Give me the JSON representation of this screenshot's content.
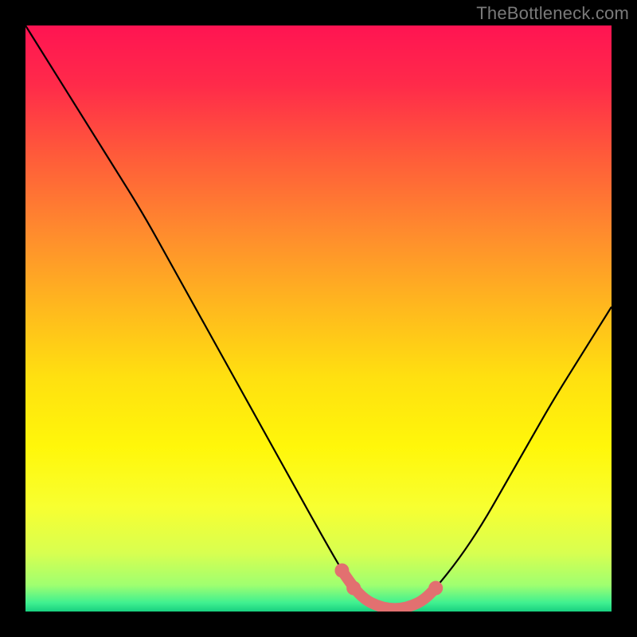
{
  "attribution": "TheBottleneck.com",
  "colors": {
    "frame": "#000000",
    "curve": "#000000",
    "marker": "#e27070",
    "gradient_stops": [
      {
        "offset": 0.0,
        "color": "#ff1452"
      },
      {
        "offset": 0.1,
        "color": "#ff2a4a"
      },
      {
        "offset": 0.22,
        "color": "#ff5a3a"
      },
      {
        "offset": 0.35,
        "color": "#ff8a2e"
      },
      {
        "offset": 0.48,
        "color": "#ffb81e"
      },
      {
        "offset": 0.6,
        "color": "#ffe010"
      },
      {
        "offset": 0.72,
        "color": "#fff70a"
      },
      {
        "offset": 0.82,
        "color": "#f8ff30"
      },
      {
        "offset": 0.9,
        "color": "#d8ff50"
      },
      {
        "offset": 0.955,
        "color": "#9fff70"
      },
      {
        "offset": 0.985,
        "color": "#40f090"
      },
      {
        "offset": 1.0,
        "color": "#18d080"
      }
    ]
  },
  "chart_data": {
    "type": "line",
    "title": "",
    "xlabel": "",
    "ylabel": "",
    "xlim": [
      0,
      100
    ],
    "ylim": [
      0,
      100
    ],
    "series": [
      {
        "name": "bottleneck-curve",
        "x": [
          0,
          5,
          10,
          15,
          20,
          25,
          30,
          35,
          40,
          45,
          50,
          54,
          56,
          58,
          60,
          62,
          64,
          66,
          68,
          70,
          74,
          78,
          82,
          86,
          90,
          95,
          100
        ],
        "y": [
          100,
          92,
          84,
          76,
          68,
          59,
          50,
          41,
          32,
          23,
          14,
          7,
          4,
          2,
          1,
          0.5,
          0.5,
          1,
          2,
          4,
          9,
          15,
          22,
          29,
          36,
          44,
          52
        ]
      }
    ],
    "markers": {
      "name": "highlight-points",
      "x": [
        54,
        56,
        58,
        60,
        62,
        64,
        66,
        68,
        70
      ],
      "y": [
        7,
        4,
        2,
        1,
        0.5,
        0.5,
        1,
        2,
        4
      ]
    }
  }
}
